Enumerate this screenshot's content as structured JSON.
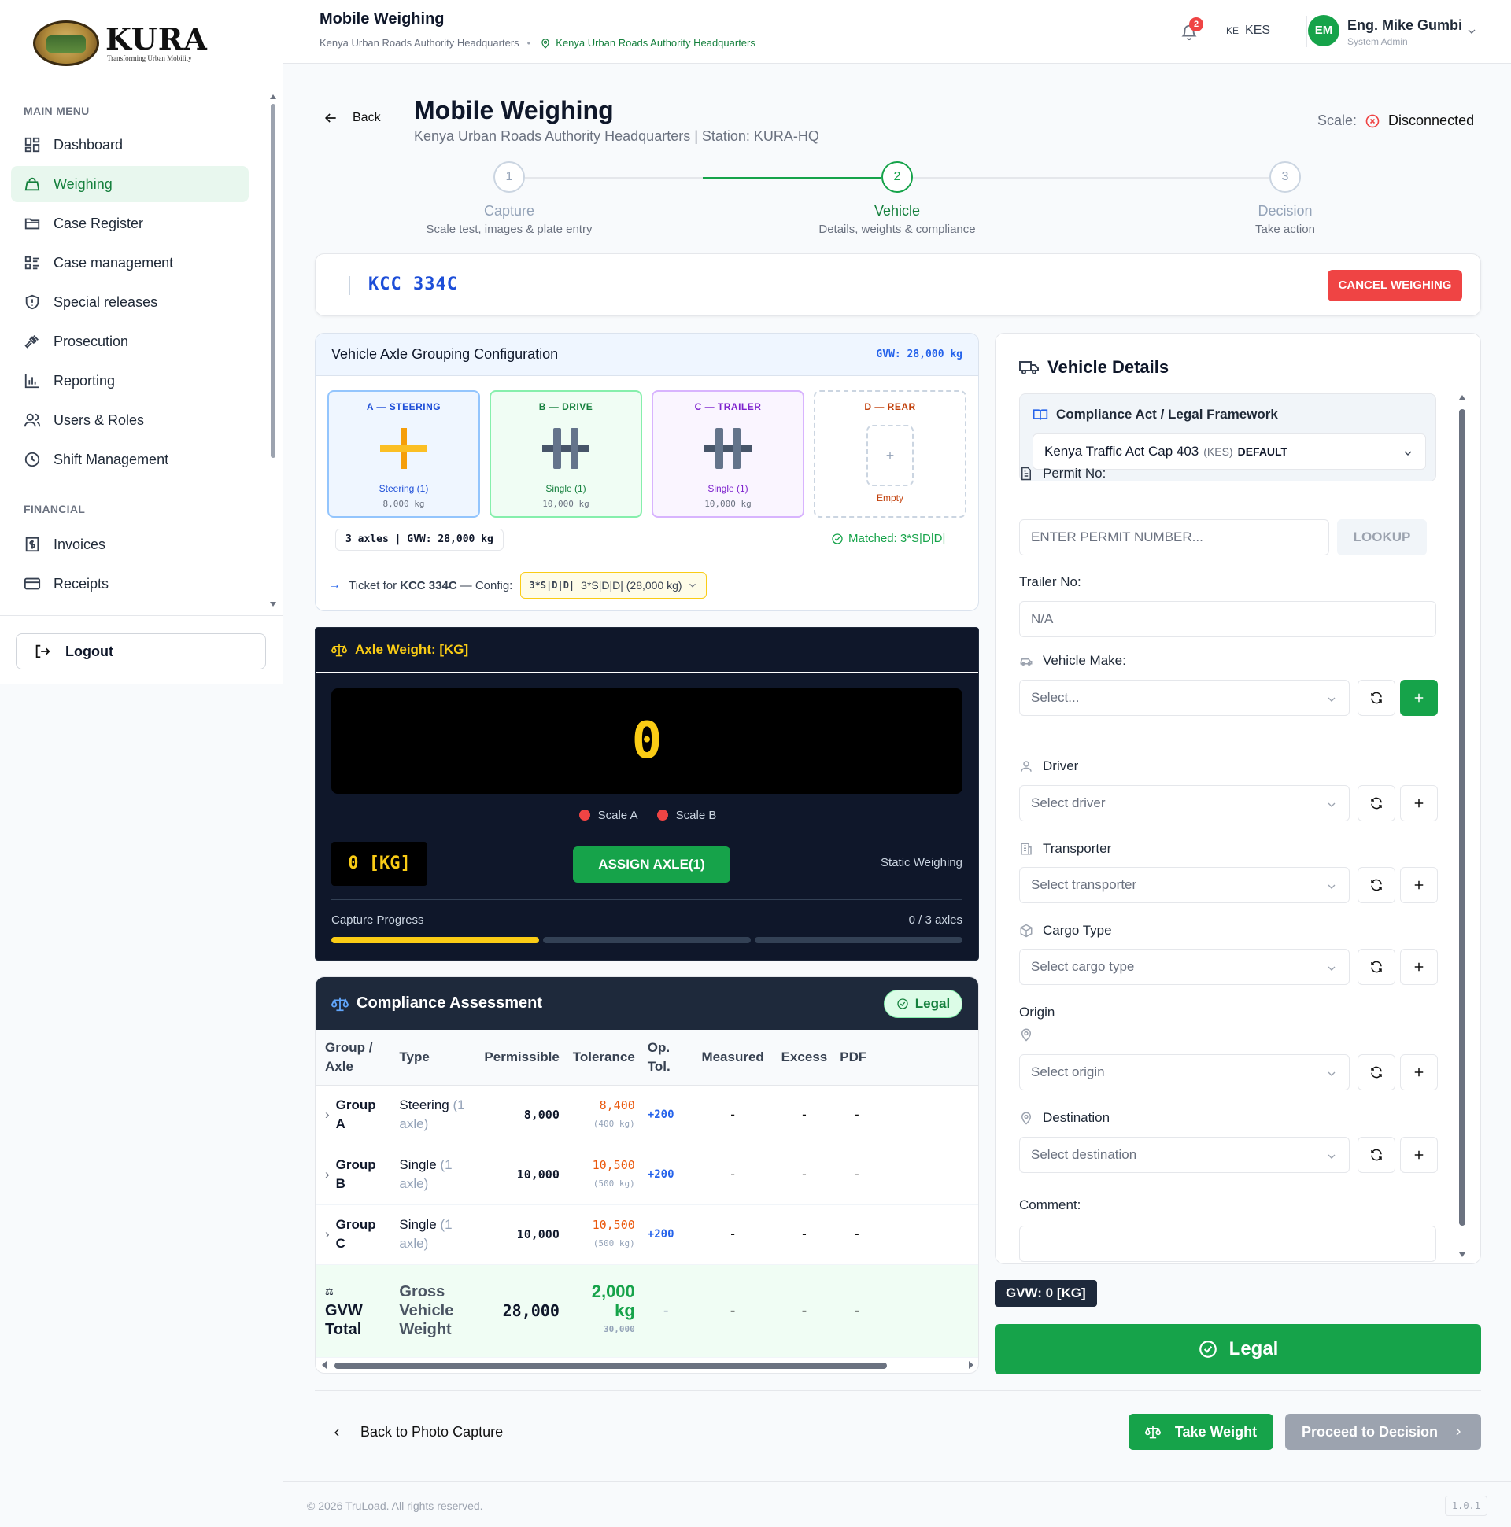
{
  "brand": {
    "name": "KURA",
    "tagline": "Transforming Urban Mobility"
  },
  "sidebar": {
    "main_title": "MAIN MENU",
    "items": [
      {
        "label": "Dashboard"
      },
      {
        "label": "Weighing"
      },
      {
        "label": "Case Register"
      },
      {
        "label": "Case management"
      },
      {
        "label": "Special releases"
      },
      {
        "label": "Prosecution"
      },
      {
        "label": "Reporting"
      },
      {
        "label": "Users & Roles"
      },
      {
        "label": "Shift Management"
      }
    ],
    "financial_title": "FINANCIAL",
    "financial_items": [
      {
        "label": "Invoices"
      },
      {
        "label": "Receipts"
      }
    ],
    "logout": "Logout",
    "active_item": "Weighing"
  },
  "topbar": {
    "title": "Mobile Weighing",
    "subtitle": "Kenya Urban Roads Authority Headquarters",
    "location": "Kenya Urban Roads Authority Headquarters",
    "notifications": "2",
    "currency_flag": "KE",
    "currency": "KES",
    "avatar": "EM",
    "user_name": "Eng. Mike Gumbi",
    "user_role": "System Admin"
  },
  "header": {
    "back": "Back",
    "title": "Mobile Weighing",
    "subtitle": "Kenya Urban Roads Authority Headquarters | Station: KURA-HQ",
    "scale_label": "Scale:",
    "scale_status": "Disconnected"
  },
  "stepper": [
    {
      "num": "1",
      "title": "Capture",
      "desc": "Scale test, images & plate entry"
    },
    {
      "num": "2",
      "title": "Vehicle",
      "desc": "Details, weights & compliance"
    },
    {
      "num": "3",
      "title": "Decision",
      "desc": "Take action"
    }
  ],
  "plate": {
    "number": "KCC 334C",
    "cancel": "CANCEL WEIGHING"
  },
  "axle_config": {
    "title": "Vehicle Axle Grouping Configuration",
    "gvw": "GVW: 28,000 kg",
    "groups": [
      {
        "header": "A — STEERING",
        "name": "Steering (1)",
        "weight": "8,000 kg"
      },
      {
        "header": "B — DRIVE",
        "name": "Single (1)",
        "weight": "10,000 kg"
      },
      {
        "header": "C — TRAILER",
        "name": "Single (1)",
        "weight": "10,000 kg"
      },
      {
        "header": "D — REAR",
        "name": "Empty",
        "plus": "+"
      }
    ],
    "summary": "3 axles | GVW: 28,000 kg",
    "matched": "Matched: 3*S|D|D|",
    "ticket_prefix": "Ticket for",
    "ticket_plate": "KCC 334C",
    "ticket_suffix": "— Config:",
    "config_code": "3*S|D|D|",
    "config_desc": "3*S|D|D| (28,000 kg)"
  },
  "axle_weight": {
    "title": "Axle Weight: [KG]",
    "display": "0",
    "scale_a": "Scale A",
    "scale_b": "Scale B",
    "small_display": "0 [KG]",
    "assign": "ASSIGN AXLE(1)",
    "mode": "Static Weighing",
    "progress_label": "Capture Progress",
    "progress_count": "0 / 3 axles",
    "progress_segments": [
      1,
      0,
      0
    ]
  },
  "compliance": {
    "title": "Compliance Assessment",
    "status": "Legal",
    "columns": [
      "Group / Axle",
      "Type",
      "Permissible",
      "Tolerance",
      "Op. Tol.",
      "Measured",
      "Excess",
      "PDF"
    ],
    "rows": [
      {
        "group": "Group A",
        "type": "Steering",
        "type_sub": "(1 axle)",
        "permissible": "8,000",
        "tolerance": "8,400",
        "tol_sub": "(400 kg)",
        "op_tol": "+200",
        "measured": "-",
        "excess": "-",
        "pdf": "-"
      },
      {
        "group": "Group B",
        "type": "Single",
        "type_sub": "(1 axle)",
        "permissible": "10,000",
        "tolerance": "10,500",
        "tol_sub": "(500 kg)",
        "op_tol": "+200",
        "measured": "-",
        "excess": "-",
        "pdf": "-"
      },
      {
        "group": "Group C",
        "type": "Single",
        "type_sub": "(1 axle)",
        "permissible": "10,000",
        "tolerance": "10,500",
        "tol_sub": "(500 kg)",
        "op_tol": "+200",
        "measured": "-",
        "excess": "-",
        "pdf": "-"
      }
    ],
    "gvw_row": {
      "group": "GVW Total",
      "type": "Gross Vehicle Weight",
      "permissible": "28,000",
      "tolerance": "2,000 kg",
      "tol_sub": "30,000",
      "op_tol": "-",
      "measured": "-",
      "excess": "-",
      "pdf": "-"
    }
  },
  "vehicle_details": {
    "title": "Vehicle Details",
    "framework_title": "Compliance Act / Legal Framework",
    "framework_value": "Kenya Traffic Act Cap 403",
    "framework_code": "(KES)",
    "framework_default": "DEFAULT",
    "permit_label": "Permit No:",
    "permit_placeholder": "ENTER PERMIT NUMBER...",
    "lookup": "LOOKUP",
    "trailer_label": "Trailer No:",
    "trailer_value": "N/A",
    "make_label": "Vehicle Make:",
    "make_placeholder": "Select...",
    "driver_label": "Driver",
    "driver_placeholder": "Select driver",
    "transporter_label": "Transporter",
    "transporter_placeholder": "Select transporter",
    "cargo_label": "Cargo Type",
    "cargo_placeholder": "Select cargo type",
    "origin_label": "Origin",
    "origin_placeholder": "Select origin",
    "destination_label": "Destination",
    "destination_placeholder": "Select destination",
    "comment_label": "Comment:"
  },
  "gvw_badge": "GVW: 0 [KG]",
  "legal_button": "Legal",
  "actions": {
    "back": "Back to Photo Capture",
    "take_weight": "Take Weight",
    "proceed": "Proceed to Decision"
  },
  "footer": {
    "copyright": "© 2026 TruLoad. All rights reserved.",
    "version": "1.0.1"
  },
  "colors": {
    "primary": "#16a34a",
    "danger": "#ef4444",
    "accent_blue": "#1d4ed8",
    "display_yellow": "#facc15",
    "dark_panel": "#0f172a"
  }
}
